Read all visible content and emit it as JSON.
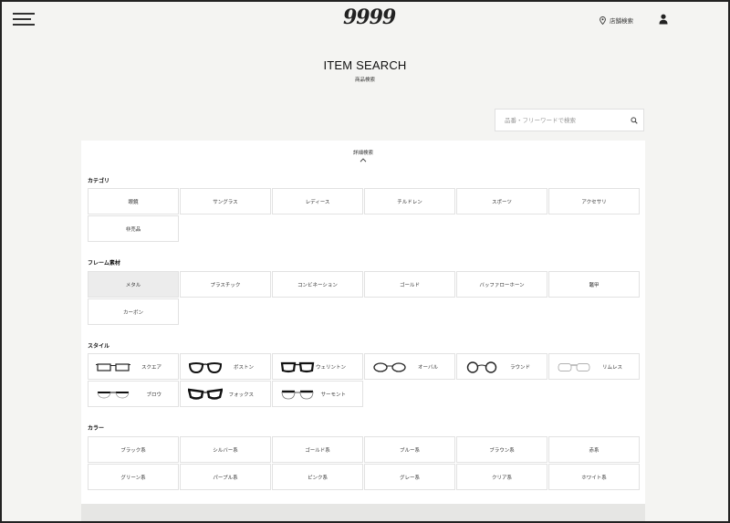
{
  "header": {
    "logo_text": "9999",
    "store_search_label": "店舗検索",
    "icons": {
      "menu": "hamburger-icon",
      "store": "location-pin-icon",
      "user": "user-icon"
    }
  },
  "page": {
    "title": "ITEM SEARCH",
    "subtitle": "商品検索"
  },
  "search": {
    "placeholder": "品番・フリーワードで検索",
    "value": ""
  },
  "advanced": {
    "toggle_label": "詳細検索"
  },
  "sections": {
    "category": {
      "label": "カテゴリ",
      "items": [
        "眼鏡",
        "サングラス",
        "レディース",
        "チルドレン",
        "スポーツ",
        "アクセサリ",
        "非売品"
      ]
    },
    "material": {
      "label": "フレーム素材",
      "selected": "メタル",
      "items": [
        "メタル",
        "プラスチック",
        "コンビネーション",
        "ゴールド",
        "バッファローホーン",
        "鼈甲",
        "カーボン"
      ]
    },
    "style": {
      "label": "スタイル",
      "items": [
        "スクエア",
        "ボストン",
        "ウェリントン",
        "オーバル",
        "ラウンド",
        "リムレス",
        "ブロウ",
        "フォックス",
        "サーモント"
      ]
    },
    "color": {
      "label": "カラー",
      "items": [
        "ブラック系",
        "シルバー系",
        "ゴールド系",
        "ブルー系",
        "ブラウン系",
        "赤系",
        "グリーン系",
        "パープル系",
        "ピンク系",
        "グレー系",
        "クリア系",
        "ホワイト系"
      ]
    }
  },
  "colors": {
    "background": "#f4f4f2",
    "panel": "#ffffff",
    "selected_cell": "#ececec",
    "border": "#e2e2e2"
  }
}
